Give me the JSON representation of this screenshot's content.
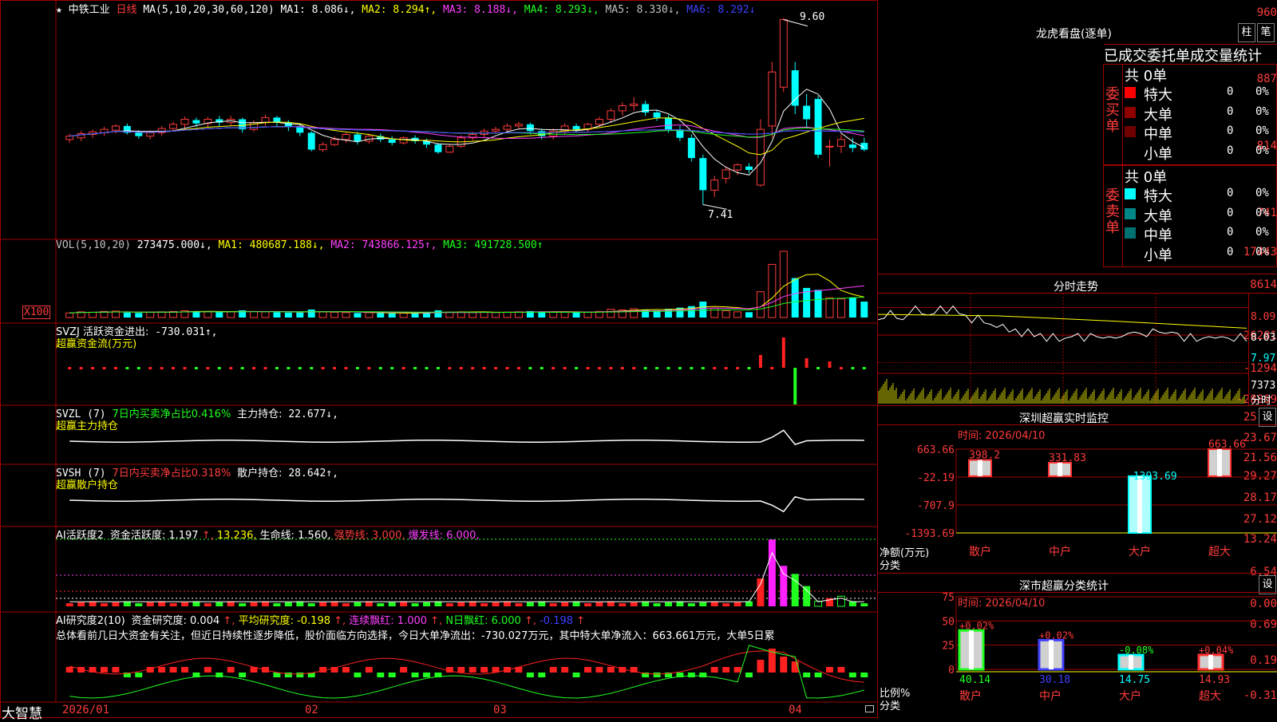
{
  "stock": {
    "star": "★",
    "name": "中铁工业",
    "period": "日线",
    "ma_header": "MA(5,10,20,30,60,120)",
    "ma": [
      {
        "label": "MA1:",
        "value": "8.086↓,",
        "color": "#ffffff"
      },
      {
        "label": "MA2:",
        "value": "8.294↑,",
        "color": "#ffff00"
      },
      {
        "label": "MA3:",
        "value": "8.188↓,",
        "color": "#ff40ff"
      },
      {
        "label": "MA4:",
        "value": "8.293↓,",
        "color": "#20ff20"
      },
      {
        "label": "MA5:",
        "value": "8.330↓,",
        "color": "#c0c0c0"
      },
      {
        "label": "MA6:",
        "value": "8.292↓",
        "color": "#4040ff"
      }
    ],
    "price_ticks": [
      "960",
      "887",
      "814",
      "741"
    ],
    "high_label": "9.60",
    "low_label": "7.41"
  },
  "vol": {
    "header": "VOL(5,10,20)",
    "value": "273475.000↓,",
    "ma": [
      {
        "label": "MA1:",
        "value": "480687.188↓,",
        "color": "#ffff00"
      },
      {
        "label": "MA2:",
        "value": "743866.125↑,",
        "color": "#ff40ff"
      },
      {
        "label": "MA3:",
        "value": "491728.500↑",
        "color": "#20ff20"
      }
    ],
    "ticks": [
      "17443",
      "8614"
    ],
    "unit": "X100"
  },
  "svzj": {
    "header": "SVZJ  活跃资金进出:",
    "value": "-730.031↑,",
    "subtitle": "超赢资金流(万元)",
    "ticks": [
      "26281",
      "-1294",
      "-28869"
    ]
  },
  "svzl": {
    "header": "SVZL (7)",
    "ratio": "7日内买卖净占比0.416%",
    "hold_label": "主力持仓:",
    "hold_value": "22.677↓,",
    "subtitle": "超赢主力持仓",
    "ticks": [
      "25.79",
      "23.67",
      "21.56"
    ]
  },
  "svsh": {
    "header": "SVSH (7)",
    "ratio": "7日内买卖净占比0.318%",
    "hold_label": "散户持仓:",
    "hold_value": "28.642↑,",
    "subtitle": "超赢散户持仓",
    "ticks": [
      "29.27",
      "28.17",
      "27.12"
    ]
  },
  "ai_active": {
    "header": "AI活跃度2",
    "items": [
      {
        "text": "资金活跃度: 1.197",
        "color": "#ffffff"
      },
      {
        "text": "↑,",
        "color": "#ff3b3b"
      },
      {
        "text": "13.236,",
        "color": "#ffff00"
      },
      {
        "text": "生命线: 1.560,",
        "color": "#ffffff"
      },
      {
        "text": "强势线: 3.000,",
        "color": "#ff3b3b"
      },
      {
        "text": "爆发线: 6.000,",
        "color": "#ff40ff"
      }
    ],
    "ticks": [
      "13.24",
      "6.54",
      "0.00"
    ]
  },
  "ai_research": {
    "header": "AI研究度2(10)",
    "items": [
      {
        "text": "资金研究度: 0.004",
        "color": "#ffffff"
      },
      {
        "text": "↑,",
        "color": "#ff3b3b"
      },
      {
        "text": "平均研究度: -0.198",
        "color": "#ffff00"
      },
      {
        "text": "↑,",
        "color": "#ff3b3b"
      },
      {
        "text": "连续飘红: 1.000",
        "color": "#ff40ff"
      },
      {
        "text": "↑,",
        "color": "#ff3b3b"
      },
      {
        "text": "N日飘红: 6.000",
        "color": "#20ff20"
      },
      {
        "text": "↑,",
        "color": "#ff3b3b"
      },
      {
        "text": "-0.198",
        "color": "#4040ff"
      },
      {
        "text": "↑",
        "color": "#ff3b3b"
      }
    ],
    "summary": "总体看前几日大资金有关注，但近日持续性逐步降低，股价面临方向选择，今日大单净流出：-730.027万元，其中特大单净流入：663.661万元，大单5日累",
    "ticks": [
      "0.69",
      "0.19",
      "-0.31"
    ]
  },
  "dates": [
    "2026/01",
    "02",
    "03",
    "04"
  ],
  "logo": "大智慧",
  "right": {
    "lh_title": "龙虎看盘(逐单)",
    "btn1": "柱",
    "btn2": "笔",
    "lh_tabs": [
      "已成交",
      "委托单",
      "成交量",
      "统计"
    ],
    "buy_label": "委买单",
    "sell_label": "委卖单",
    "buy_total": "共 0单",
    "sell_total": "共 0单",
    "buy_rows": [
      {
        "name": "特大",
        "qty": "0",
        "pct": "0%",
        "color": "#ff0000"
      },
      {
        "name": "大单",
        "qty": "0",
        "pct": "0%",
        "color": "#900000"
      },
      {
        "name": "中单",
        "qty": "0",
        "pct": "0%",
        "color": "#700000"
      },
      {
        "name": "小单",
        "qty": "0",
        "pct": "0%",
        "color": "#000000"
      }
    ],
    "sell_rows": [
      {
        "name": "特大",
        "qty": "0",
        "pct": "0%",
        "color": "#00ffff"
      },
      {
        "name": "大单",
        "qty": "0",
        "pct": "0%",
        "color": "#008888"
      },
      {
        "name": "中单",
        "qty": "0",
        "pct": "0%",
        "color": "#007070"
      },
      {
        "name": "小单",
        "qty": "0",
        "pct": "0%",
        "color": "#000000"
      }
    ],
    "intraday_title": "分时走势",
    "intraday_ticks": [
      "8.09",
      "8.03",
      "7.97",
      "7373",
      "分时"
    ],
    "sz_title": "深圳超赢实时监控",
    "sz_settings": "设",
    "sz_time": "时间: 2026/04/10",
    "sz_ticks": [
      "663.66",
      "-22.19",
      "-707.9",
      "-1393.69"
    ],
    "sz_axis_label1": "净额(万元)",
    "sz_axis_label2": "分类",
    "sz_cats": [
      "散户",
      "中户",
      "大户",
      "超大"
    ],
    "sz_values": [
      398.2,
      331.83,
      -1393.69,
      663.66
    ],
    "sz_value_labels": [
      "398.2",
      "331.83",
      "-1393.69",
      "663.66"
    ],
    "sh_title": "深市超赢分类统计",
    "sh_settings": "设",
    "sh_time": "时间: 2026/04/10",
    "sh_ticks": [
      "75",
      "50",
      "25",
      "0"
    ],
    "sh_axis_label1": "比例%",
    "sh_axis_label2": "分类",
    "sh_cats": [
      "散户",
      "中户",
      "大户",
      "超大"
    ],
    "sh_values": [
      40.14,
      30.18,
      14.75,
      14.93
    ],
    "sh_value_labels": [
      "40.14",
      "30.18",
      "14.75",
      "14.93"
    ],
    "sh_changes": [
      "+0.02%",
      "+0.02%",
      "-0.08%",
      "+0.04%"
    ]
  },
  "chart_data": [
    {
      "type": "candlestick",
      "title": "中铁工业 日线",
      "ylim": [
        7.3,
        9.7
      ],
      "note": "approximate daily candles Jan–Apr 2026, values in yuan",
      "candles": [
        [
          8.18,
          8.22,
          8.25,
          8.14
        ],
        [
          8.2,
          8.25,
          8.28,
          8.16
        ],
        [
          8.24,
          8.27,
          8.3,
          8.2
        ],
        [
          8.26,
          8.3,
          8.33,
          8.22
        ],
        [
          8.29,
          8.34,
          8.36,
          8.25
        ],
        [
          8.34,
          8.26,
          8.37,
          8.24
        ],
        [
          8.26,
          8.22,
          8.29,
          8.19
        ],
        [
          8.22,
          8.26,
          8.29,
          8.18
        ],
        [
          8.26,
          8.31,
          8.34,
          8.22
        ],
        [
          8.31,
          8.36,
          8.39,
          8.28
        ],
        [
          8.36,
          8.42,
          8.45,
          8.3
        ],
        [
          8.41,
          8.37,
          8.44,
          8.33
        ],
        [
          8.37,
          8.42,
          8.45,
          8.33
        ],
        [
          8.42,
          8.38,
          8.46,
          8.34
        ],
        [
          8.38,
          8.42,
          8.46,
          8.34
        ],
        [
          8.42,
          8.3,
          8.44,
          8.26
        ],
        [
          8.3,
          8.38,
          8.41,
          8.27
        ],
        [
          8.38,
          8.44,
          8.47,
          8.34
        ],
        [
          8.44,
          8.38,
          8.46,
          8.33
        ],
        [
          8.38,
          8.33,
          8.41,
          8.28
        ],
        [
          8.33,
          8.26,
          8.36,
          8.22
        ],
        [
          8.26,
          8.06,
          8.28,
          8.04
        ],
        [
          8.06,
          8.12,
          8.15,
          8.03
        ],
        [
          8.12,
          8.18,
          8.22,
          8.1
        ],
        [
          8.18,
          8.24,
          8.26,
          8.14
        ],
        [
          8.24,
          8.16,
          8.27,
          8.12
        ],
        [
          8.16,
          8.22,
          8.25,
          8.13
        ],
        [
          8.22,
          8.18,
          8.25,
          8.15
        ],
        [
          8.18,
          8.14,
          8.22,
          8.11
        ],
        [
          8.14,
          8.2,
          8.22,
          8.12
        ],
        [
          8.2,
          8.16,
          8.23,
          8.13
        ],
        [
          8.16,
          8.12,
          8.19,
          8.08
        ],
        [
          8.12,
          8.03,
          8.14,
          8.01
        ],
        [
          8.03,
          8.1,
          8.12,
          8.02
        ],
        [
          8.1,
          8.2,
          8.23,
          8.08
        ],
        [
          8.2,
          8.24,
          8.27,
          8.17
        ],
        [
          8.24,
          8.28,
          8.31,
          8.2
        ],
        [
          8.28,
          8.3,
          8.33,
          8.25
        ],
        [
          8.3,
          8.34,
          8.37,
          8.27
        ],
        [
          8.34,
          8.36,
          8.39,
          8.31
        ],
        [
          8.36,
          8.28,
          8.38,
          8.24
        ],
        [
          8.28,
          8.22,
          8.31,
          8.18
        ],
        [
          8.22,
          8.28,
          8.31,
          8.18
        ],
        [
          8.28,
          8.34,
          8.37,
          8.24
        ],
        [
          8.34,
          8.3,
          8.37,
          8.27
        ],
        [
          8.3,
          8.36,
          8.38,
          8.27
        ],
        [
          8.36,
          8.42,
          8.45,
          8.33
        ],
        [
          8.42,
          8.52,
          8.55,
          8.38
        ],
        [
          8.52,
          8.58,
          8.62,
          8.46
        ],
        [
          8.58,
          8.6,
          8.68,
          8.52
        ],
        [
          8.6,
          8.5,
          8.64,
          8.46
        ],
        [
          8.5,
          8.44,
          8.53,
          8.4
        ],
        [
          8.44,
          8.3,
          8.47,
          8.26
        ],
        [
          8.3,
          8.2,
          8.34,
          8.16
        ],
        [
          8.2,
          7.96,
          8.24,
          7.92
        ],
        [
          7.96,
          7.58,
          8.0,
          7.41
        ],
        [
          7.58,
          7.7,
          7.75,
          7.5
        ],
        [
          7.72,
          7.82,
          7.86,
          7.66
        ],
        [
          7.82,
          7.88,
          7.9,
          7.76
        ],
        [
          7.86,
          7.82,
          7.9,
          7.78
        ],
        [
          7.64,
          8.3,
          8.42,
          7.62
        ],
        [
          8.34,
          8.98,
          9.1,
          8.2
        ],
        [
          8.8,
          9.6,
          9.62,
          8.74
        ],
        [
          9.0,
          8.58,
          9.1,
          8.48
        ],
        [
          8.58,
          8.42,
          8.72,
          8.32
        ],
        [
          8.66,
          8.0,
          8.7,
          7.96
        ],
        [
          8.1,
          8.1,
          8.18,
          7.86
        ],
        [
          8.1,
          8.18,
          8.24,
          8.02
        ],
        [
          8.12,
          8.08,
          8.2,
          8.03
        ],
        [
          8.14,
          8.06,
          8.2,
          8.04
        ]
      ]
    },
    {
      "type": "bar",
      "title": "VOL(5,10,20)",
      "ylim": [
        0,
        18500
      ],
      "values": [
        1200,
        1500,
        1400,
        1600,
        1700,
        1300,
        1200,
        1400,
        1500,
        1600,
        1800,
        1700,
        1500,
        1400,
        1500,
        1900,
        1600,
        1500,
        1400,
        1300,
        1300,
        2100,
        1500,
        1400,
        1300,
        1200,
        1300,
        1200,
        1100,
        1200,
        1100,
        1300,
        1900,
        1400,
        1500,
        1300,
        1400,
        1300,
        1400,
        1500,
        1700,
        1600,
        1400,
        1500,
        1300,
        1400,
        1600,
        2200,
        2000,
        2300,
        2100,
        1900,
        2300,
        2600,
        3000,
        4200,
        2500,
        1800,
        1500,
        1400,
        6800,
        14000,
        17443,
        10400,
        7800,
        7300,
        5200,
        4900,
        5300,
        4200
      ],
      "up": [
        true,
        true,
        true,
        true,
        true,
        false,
        false,
        true,
        true,
        true,
        true,
        false,
        true,
        false,
        true,
        false,
        true,
        true,
        false,
        false,
        false,
        false,
        true,
        true,
        true,
        false,
        true,
        false,
        false,
        true,
        false,
        false,
        false,
        true,
        true,
        true,
        true,
        true,
        true,
        true,
        false,
        false,
        true,
        true,
        false,
        true,
        true,
        true,
        true,
        true,
        false,
        false,
        false,
        false,
        false,
        false,
        true,
        true,
        true,
        false,
        true,
        true,
        true,
        false,
        false,
        false,
        true,
        true,
        false,
        false
      ]
    },
    {
      "type": "line",
      "title": "分时走势",
      "ylim": [
        7.95,
        8.11
      ],
      "values": [
        8.06,
        8.07,
        8.08,
        8.07,
        8.06,
        8.08,
        8.09,
        8.08,
        8.07,
        8.08,
        8.09,
        8.08,
        8.09,
        8.08,
        8.07,
        8.06,
        8.07,
        8.06,
        8.05,
        8.05,
        8.05,
        8.04,
        8.04,
        8.03,
        8.04,
        8.03,
        8.03,
        8.02,
        8.03,
        8.02,
        8.02,
        8.03,
        8.03,
        8.02,
        8.03,
        8.03,
        8.02,
        8.03,
        8.02,
        8.03,
        8.03,
        8.04,
        8.03,
        8.03,
        8.04,
        8.04,
        8.03,
        8.04,
        8.03,
        8.02,
        8.03,
        8.02,
        8.02,
        8.03,
        8.02,
        8.03,
        8.02,
        8.02,
        8.03,
        8.02
      ]
    },
    {
      "type": "bar",
      "title": "深圳超赢实时监控",
      "categories": [
        "散户",
        "中户",
        "大户",
        "超大"
      ],
      "values": [
        398.2,
        331.83,
        -1393.69,
        663.66
      ],
      "ylim": [
        -1393.69,
        663.66
      ]
    },
    {
      "type": "bar",
      "title": "深市超赢分类统计",
      "categories": [
        "散户",
        "中户",
        "大户",
        "超大"
      ],
      "values": [
        40.14,
        30.18,
        14.75,
        14.93
      ],
      "ylim": [
        0,
        75
      ]
    }
  ]
}
